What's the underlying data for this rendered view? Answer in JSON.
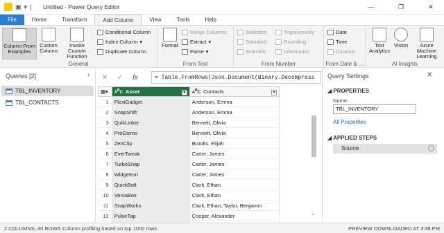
{
  "window": {
    "title": "Untitled - Power Query Editor",
    "minimize": "—",
    "restore": "❐",
    "close": "✕"
  },
  "tabs": [
    "File",
    "Home",
    "Transform",
    "Add Column",
    "View",
    "Tools",
    "Help"
  ],
  "ribbon": {
    "general": {
      "label": "General",
      "col_from_examples": "Column From Examples",
      "custom_column": "Custom Column",
      "invoke_custom_function": "Invoke Custom Function",
      "conditional_column": "Conditional Column",
      "index_column": "Index Column",
      "duplicate_column": "Duplicate Column"
    },
    "from_text": {
      "label": "From Text",
      "format": "Format",
      "merge_columns": "Merge Columns",
      "extract": "Extract",
      "parse": "Parse"
    },
    "from_number": {
      "label": "From Number",
      "statistics": "Statistics",
      "standard": "Standard",
      "scientific": "Scientific",
      "trigonometry": "Trigonometry",
      "rounding": "Rounding",
      "information": "Information"
    },
    "from_date": {
      "label": "From Date & ...",
      "date": "Date",
      "time": "Time",
      "duration": "Duration"
    },
    "ai": {
      "label": "AI Insights",
      "text_analytics": "Text Analytics",
      "vision": "Vision",
      "azure_ml": "Azure Machine Learning"
    }
  },
  "queries": {
    "title": "Queries [2]",
    "items": [
      "TBL_INVENTORY",
      "TBL_CONTACTS"
    ]
  },
  "formula": "= Table.FromRows(Json.Document(Binary.Decompress",
  "table": {
    "columns": [
      "Asset",
      "Contacts"
    ],
    "rows": [
      [
        "1",
        "FlexiGadget",
        "Anderson, Emma"
      ],
      [
        "2",
        "SnapShift",
        "Anderson, Emma"
      ],
      [
        "3",
        "QuikLinker",
        "Bennett, Olivia"
      ],
      [
        "4",
        "ProGizmo",
        "Bennett, Olivia"
      ],
      [
        "5",
        "ZenClip",
        "Brooks, Elijah"
      ],
      [
        "6",
        "EverTweak",
        "Carter, James"
      ],
      [
        "7",
        "TurboSnap",
        "Carter, James"
      ],
      [
        "8",
        "Widgetron",
        "Carter, James"
      ],
      [
        "9",
        "QuickBolt",
        "Clark, Ethan"
      ],
      [
        "10",
        "VersaBox",
        "Clark, Ethan"
      ],
      [
        "11",
        "SnapWorks",
        "Clark, Ethan; Taylor, Benjamin"
      ],
      [
        "12",
        "PulseTap",
        "Cooper, Alexander"
      ],
      [
        "13",
        "UltraGrip",
        "Cooper, Alexander"
      ]
    ]
  },
  "settings": {
    "title": "Query Settings",
    "properties": "PROPERTIES",
    "name_label": "Name",
    "name_value": "TBL_INVENTORY",
    "all_properties": "All Properties",
    "applied_steps": "APPLIED STEPS",
    "step": "Source"
  },
  "status": {
    "left": "2 COLUMNS, 40 ROWS",
    "mid": "Column profiling based on top 1000 rows",
    "right": "PREVIEW DOWNLOADED AT 3:38 PM"
  }
}
